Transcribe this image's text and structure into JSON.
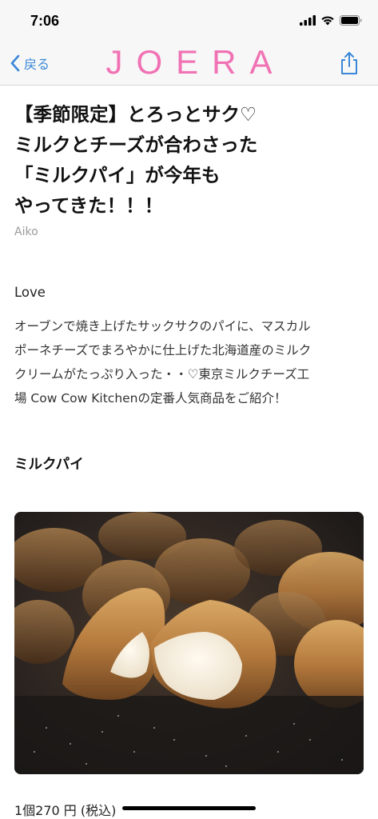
{
  "status": {
    "time": "7:06"
  },
  "nav": {
    "back_label": "戻る",
    "logo": "JOERA",
    "accent_color": "#f072b4",
    "link_color": "#3a87d8"
  },
  "article": {
    "title_lines": [
      "【季節限定】とろっとサク♡",
      "ミルクとチーズが合わさった",
      "「ミルクパイ」が今年も",
      "やってきた！！！"
    ],
    "author": "Aiko",
    "category": "Love",
    "intro_lines": [
      "オーブンで焼き上げたサックサクのパイに、マスカル",
      "ポーネチーズでまろやかに仕上げた北海道産のミルク",
      "クリームがたっぷり入った・・♡東京ミルクチーズ工",
      "場 Cow Cow Kitchenの定番人気商品をご紹介！"
    ],
    "section_heading": "ミルクパイ",
    "price": "1個270 円 (税込)"
  }
}
